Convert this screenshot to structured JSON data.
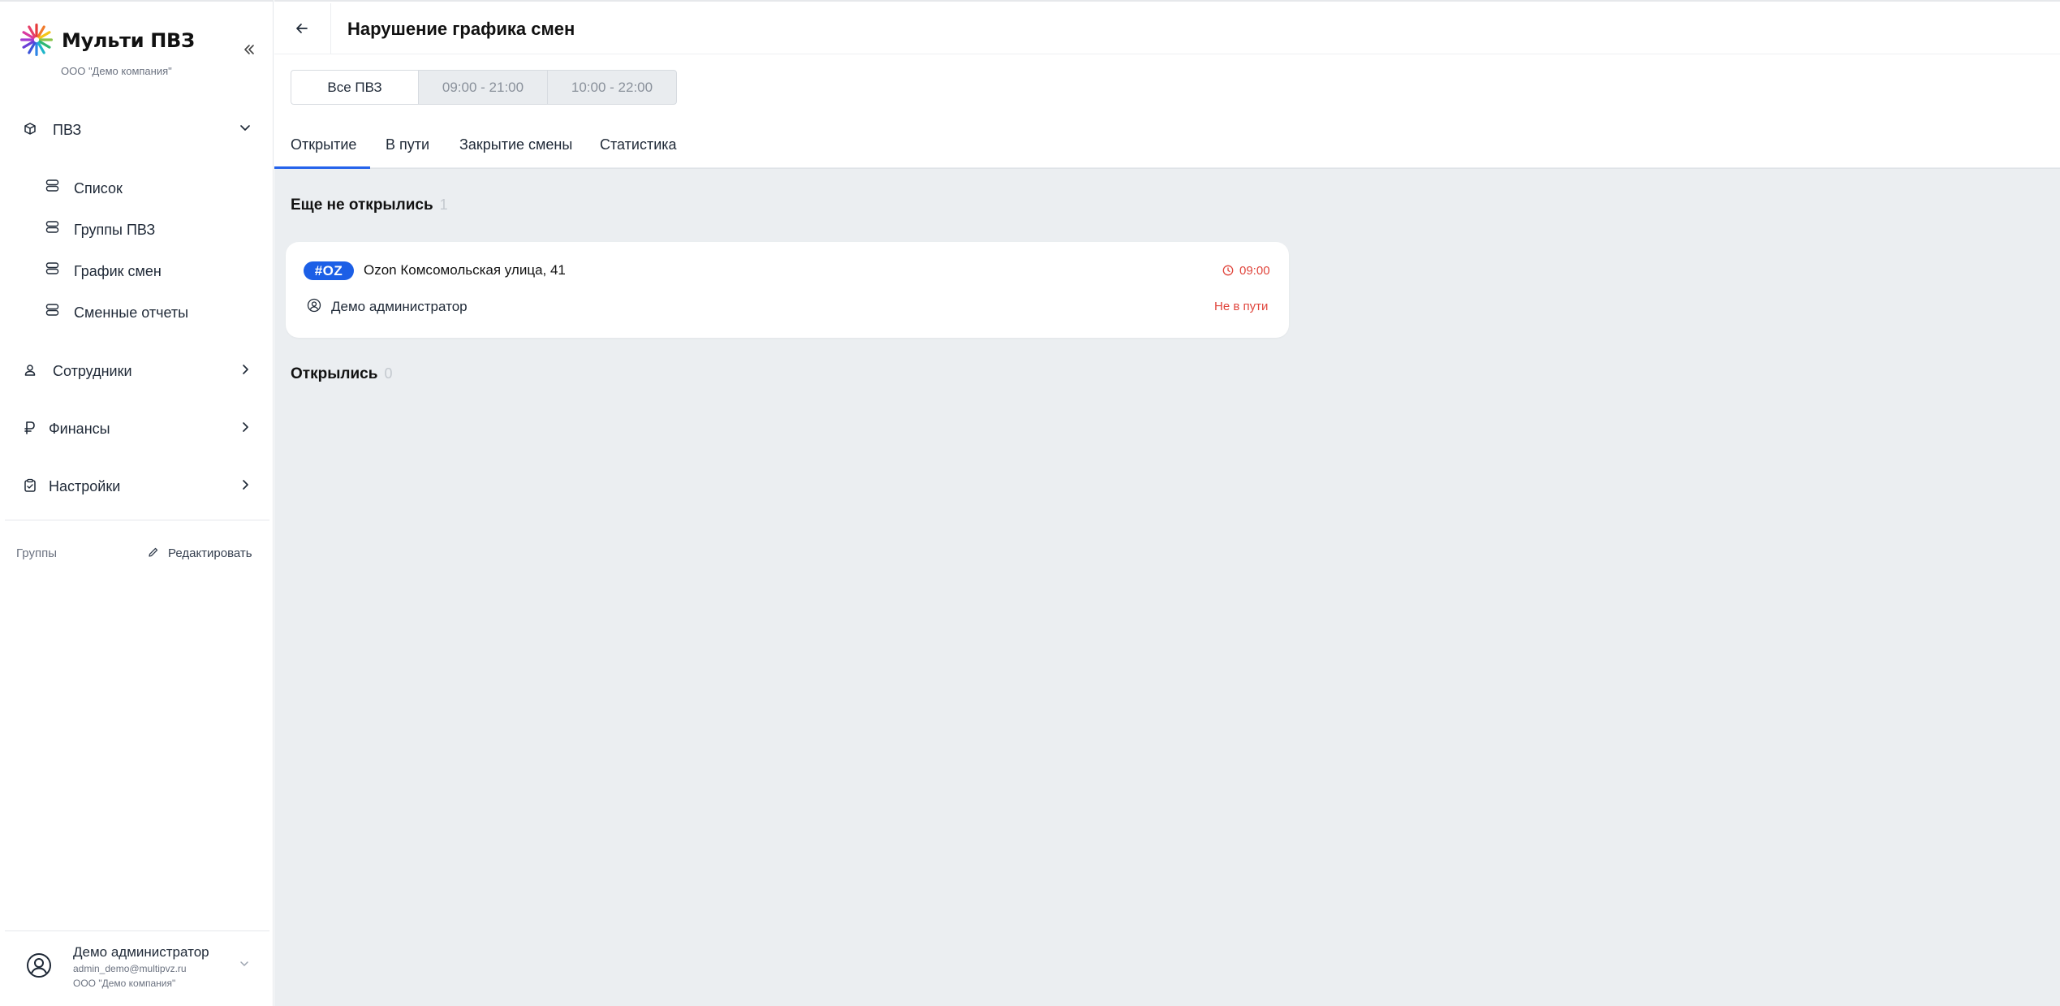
{
  "sidebar": {
    "brand": {
      "title": "Мульти ПВЗ",
      "company": "ООО \"Демо компания\""
    },
    "collapse_icon": "double-chevron-left-icon",
    "nav": [
      {
        "label": "ПВЗ",
        "icon": "cube-icon",
        "expanded": true,
        "children": [
          {
            "label": "Список",
            "icon": "stack-icon"
          },
          {
            "label": "Группы ПВЗ",
            "icon": "stack-icon"
          },
          {
            "label": "График смен",
            "icon": "stack-icon"
          },
          {
            "label": "Сменные отчеты",
            "icon": "stack-icon"
          }
        ]
      },
      {
        "label": "Сотрудники",
        "icon": "person-icon",
        "expanded": false
      },
      {
        "label": "Финансы",
        "icon": "ruble-icon",
        "expanded": false
      },
      {
        "label": "Настройки",
        "icon": "clipboard-icon",
        "expanded": false
      }
    ],
    "groups_label": "Группы",
    "edit_label": "Редактировать",
    "user": {
      "name": "Демо администратор",
      "email": "admin_demo@multipvz.ru",
      "company": "ООО \"Демо компания\""
    }
  },
  "header": {
    "title": "Нарушение графика смен",
    "segments": [
      {
        "label": "Все ПВЗ",
        "active": true
      },
      {
        "label": "09:00 - 21:00",
        "active": false
      },
      {
        "label": "10:00 - 22:00",
        "active": false
      }
    ],
    "tabs": [
      {
        "label": "Открытие",
        "active": true
      },
      {
        "label": "В пути",
        "active": false
      },
      {
        "label": "Закрытие смены",
        "active": false
      },
      {
        "label": "Статистика",
        "active": false
      }
    ]
  },
  "content": {
    "not_opened": {
      "title": "Еще не открылись",
      "count": "1",
      "items": [
        {
          "badge": "#OZ",
          "title": "Ozon Комсомольская улица, 41",
          "time": "09:00",
          "person": "Демо администратор",
          "status": "Не в пути"
        }
      ]
    },
    "opened": {
      "title": "Открылись",
      "count": "0"
    }
  },
  "colors": {
    "accent": "#2563eb",
    "badge": "#1c5fe6",
    "danger": "#e0453c",
    "background": "#ebeef1"
  }
}
